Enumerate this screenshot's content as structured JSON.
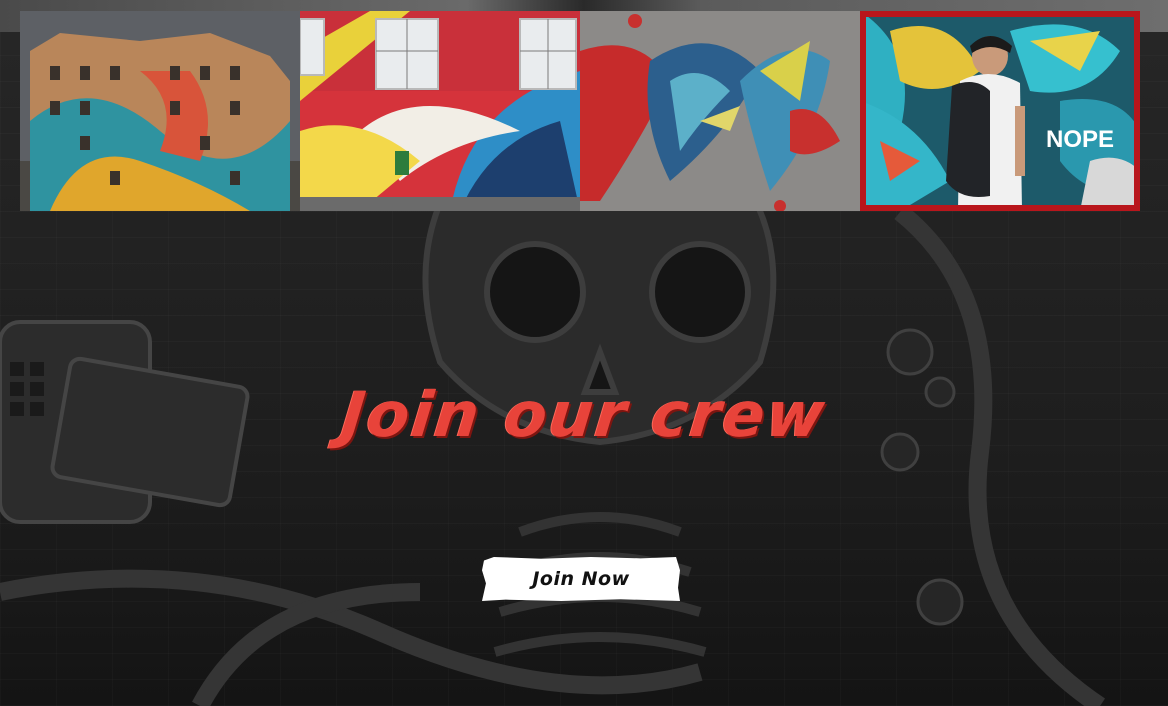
{
  "gallery": {
    "items": [
      {
        "name": "painted-building",
        "selected": false
      },
      {
        "name": "red-mural-wall-with-chair",
        "selected": false
      },
      {
        "name": "abstract-graffiti",
        "selected": false
      },
      {
        "name": "man-walking-by-graffiti",
        "selected": true,
        "graffiti_text": "NOPE"
      }
    ]
  },
  "hero": {
    "headline": "Join our crew",
    "button_label": "Join Now"
  },
  "colors": {
    "accent": "#e8433a",
    "selection_border": "#b9161c",
    "button_bg": "#ffffff",
    "page_bg": "#1b1b1b"
  }
}
